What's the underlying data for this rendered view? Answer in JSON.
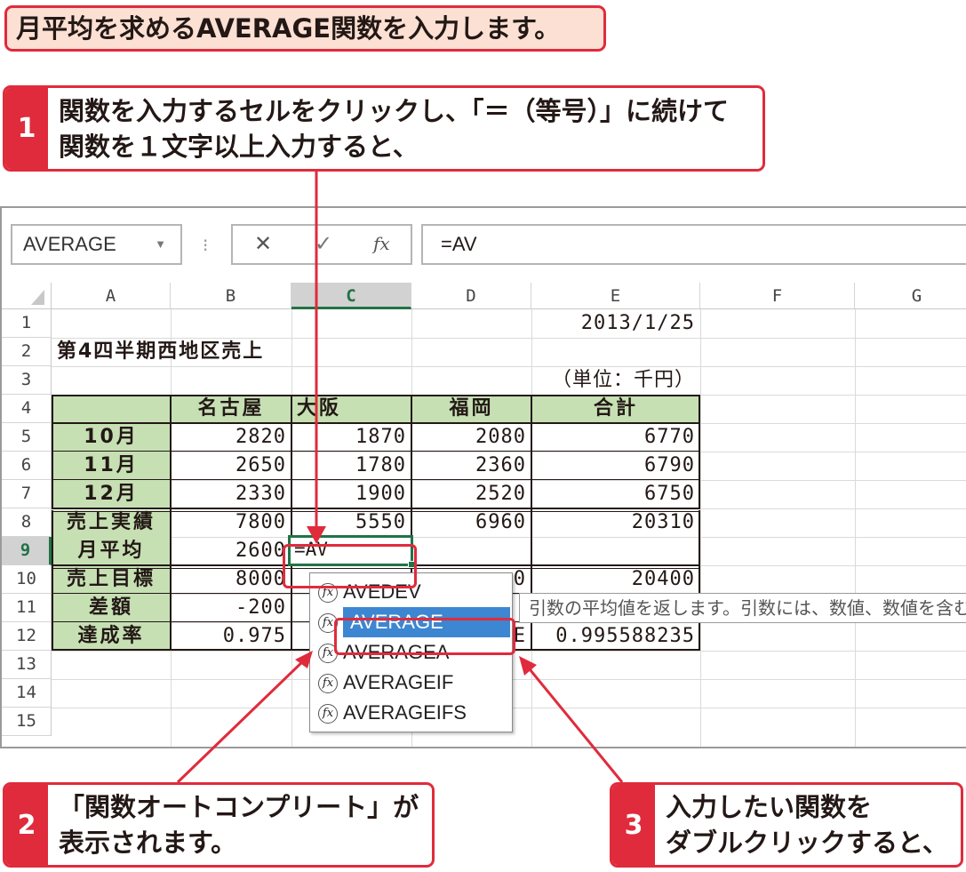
{
  "banner": {
    "text": "月平均を求めるAVERAGE関数を入力します。"
  },
  "steps": [
    {
      "num": "1",
      "lines": [
        "関数を入力するセルをクリックし、「＝（等号）」に続けて",
        "関数を１文字以上入力すると、"
      ]
    },
    {
      "num": "2",
      "lines": [
        "「関数オートコンプリート」が",
        "表示されます。"
      ]
    },
    {
      "num": "3",
      "lines": [
        "入力したい関数を",
        "ダブルクリックすると、"
      ]
    }
  ],
  "formula_bar": {
    "name_box": "AVERAGE",
    "cancel_icon": "✕",
    "enter_icon": "✓",
    "fx_icon": "fx",
    "formula": "=AV"
  },
  "columns": [
    "A",
    "B",
    "C",
    "D",
    "E",
    "F",
    "G"
  ],
  "active_column": "C",
  "rows": [
    "1",
    "2",
    "3",
    "4",
    "5",
    "6",
    "7",
    "8",
    "9",
    "10",
    "11",
    "12",
    "13",
    "14",
    "15"
  ],
  "active_row": "9",
  "cells": {
    "E1": "2013/1/25",
    "A2": "第4四半期西地区売上",
    "E3": "（単位：千円）",
    "B4": "名古屋",
    "C4": "大阪",
    "D4": "福岡",
    "E4": "合計",
    "A5": "10月",
    "B5": "2820",
    "C5": "1870",
    "D5": "2080",
    "E5": "6770",
    "A6": "11月",
    "B6": "2650",
    "C6": "1780",
    "D6": "2360",
    "E6": "6790",
    "A7": "12月",
    "B7": "2330",
    "C7": "1900",
    "D7": "2520",
    "E7": "6750",
    "A8": "売上実績",
    "B8": "7800",
    "C8": "5550",
    "D8": "6960",
    "E8": "20310",
    "A9": "月平均",
    "B9": "2600",
    "C9": "=AV",
    "A10": "売上目標",
    "B10": "8000",
    "D10": "0",
    "E10": "20400",
    "A11": "差額",
    "B11": "-200",
    "A12": "達成率",
    "B12": "0.975",
    "D12": "E",
    "E12": "0.995588235"
  },
  "autocomplete": {
    "items": [
      "AVEDEV",
      "AVERAGE",
      "AVERAGEA",
      "AVERAGEIF",
      "AVERAGEIFS"
    ],
    "selected_index": 1,
    "tooltip": "引数の平均値を返します。引数には、数値、数値を含む"
  },
  "colors": {
    "accent_red": "#e02b3c",
    "header_green": "#c6e0b4",
    "excel_green": "#217346",
    "selection_blue": "#3d86d1"
  }
}
